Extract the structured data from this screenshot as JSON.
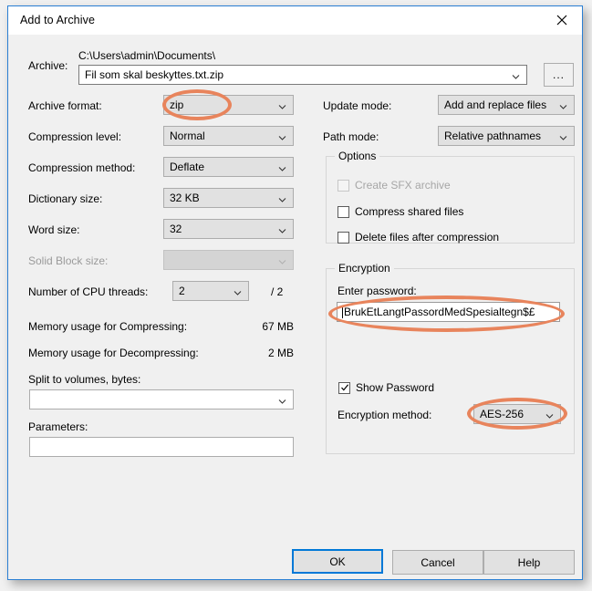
{
  "window": {
    "title": "Add to Archive",
    "close_icon": "close-icon"
  },
  "archive": {
    "label": "Archive:",
    "path": "C:\\Users\\admin\\Documents\\",
    "filename": "Fil som skal beskyttes.txt.zip",
    "browse_label": "..."
  },
  "left": {
    "archive_format": {
      "label": "Archive format:",
      "value": "zip"
    },
    "compression_level": {
      "label": "Compression level:",
      "value": "Normal"
    },
    "compression_method": {
      "label": "Compression method:",
      "value": "Deflate"
    },
    "dictionary_size": {
      "label": "Dictionary size:",
      "value": "32 KB"
    },
    "word_size": {
      "label": "Word size:",
      "value": "32"
    },
    "solid_block_size": {
      "label": "Solid Block size:",
      "value": ""
    },
    "cpu_threads": {
      "label": "Number of CPU threads:",
      "value": "2",
      "total": "/ 2"
    },
    "mem_compress": {
      "label": "Memory usage for Compressing:",
      "value": "67 MB"
    },
    "mem_decompress": {
      "label": "Memory usage for Decompressing:",
      "value": "2 MB"
    },
    "split_volumes": {
      "label": "Split to volumes, bytes:",
      "value": ""
    },
    "parameters": {
      "label": "Parameters:",
      "value": ""
    }
  },
  "right": {
    "update_mode": {
      "label": "Update mode:",
      "value": "Add and replace files"
    },
    "path_mode": {
      "label": "Path mode:",
      "value": "Relative pathnames"
    },
    "options": {
      "title": "Options",
      "items": [
        {
          "label": "Create SFX archive",
          "checked": false,
          "disabled": true
        },
        {
          "label": "Compress shared files",
          "checked": false,
          "disabled": false
        },
        {
          "label": "Delete files after compression",
          "checked": false,
          "disabled": false
        }
      ]
    },
    "encryption": {
      "title": "Encryption",
      "password_label": "Enter password:",
      "password_value": "BrukEtLangtPassordMedSpesialtegn$£",
      "show_password": {
        "label": "Show Password",
        "checked": true
      },
      "method": {
        "label": "Encryption method:",
        "value": "AES-256"
      }
    }
  },
  "buttons": {
    "ok": "OK",
    "cancel": "Cancel",
    "help": "Help"
  },
  "annotations": {
    "accent_color": "#e8845c",
    "highlights": [
      "archive-format-combo",
      "password-field",
      "encryption-method-combo"
    ]
  }
}
